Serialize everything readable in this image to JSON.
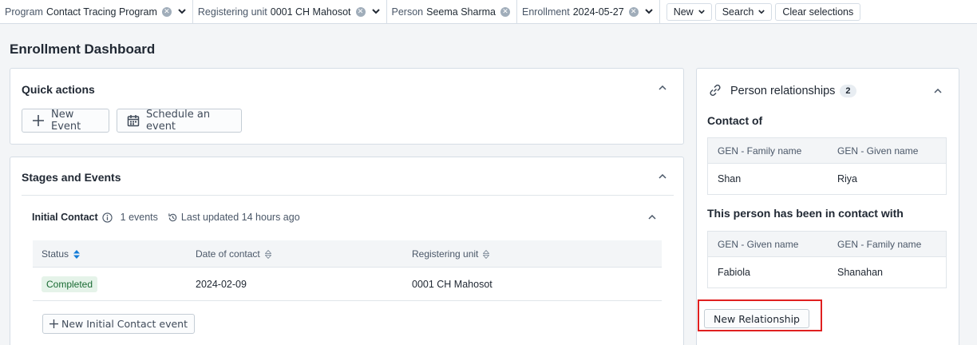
{
  "topbar": {
    "chips": [
      {
        "label": "Program",
        "value": "Contact Tracing Program",
        "dropdown": true
      },
      {
        "label": "Registering unit",
        "value": "0001 CH Mahosot",
        "dropdown": true
      },
      {
        "label": "Person",
        "value": "Seema Sharma",
        "dropdown": false
      },
      {
        "label": "Enrollment",
        "value": "2024-05-27",
        "dropdown": true
      }
    ],
    "new_label": "New",
    "search_label": "Search",
    "clear_label": "Clear selections"
  },
  "page": {
    "title": "Enrollment Dashboard"
  },
  "quick_actions": {
    "title": "Quick actions",
    "new_event_label": "New Event",
    "schedule_label": "Schedule an event"
  },
  "stages": {
    "title": "Stages and Events",
    "stage_name": "Initial Contact",
    "events_count": "1 events",
    "last_updated": "Last updated 14 hours ago",
    "columns": [
      "Status",
      "Date of contact",
      "Registering unit"
    ],
    "rows": [
      {
        "status": "Completed",
        "date": "2024-02-09",
        "unit": "0001 CH Mahosot"
      }
    ],
    "new_event_label": "New Initial Contact event"
  },
  "relationships": {
    "title": "Person relationships",
    "count": "2",
    "contact_of": {
      "title": "Contact of",
      "columns": [
        "GEN - Family name",
        "GEN - Given name"
      ],
      "rows": [
        [
          "Shan",
          "Riya"
        ]
      ]
    },
    "in_contact_with": {
      "title": "This person has been in contact with",
      "columns": [
        "GEN - Given name",
        "GEN - Family name"
      ],
      "rows": [
        [
          "Fabiola",
          "Shanahan"
        ]
      ]
    },
    "new_relationship_label": "New Relationship"
  },
  "colors": {
    "highlight": "#e02020",
    "completed_bg": "#e5f3e9",
    "sort_active": "#147cd7"
  }
}
